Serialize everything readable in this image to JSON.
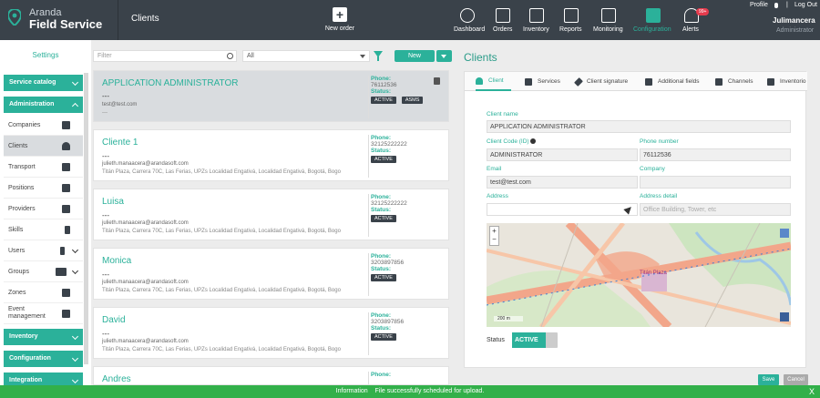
{
  "app": {
    "brand_top": "Aranda",
    "brand_bottom": "Field Service",
    "page_title": "Clients"
  },
  "header": {
    "new_order": "New order",
    "nav": [
      {
        "label": "Dashboard"
      },
      {
        "label": "Orders"
      },
      {
        "label": "Inventory"
      },
      {
        "label": "Reports"
      },
      {
        "label": "Monitoring"
      },
      {
        "label": "Configuration"
      },
      {
        "label": "Alerts"
      }
    ],
    "alerts_badge": "99+",
    "profile": "Profile",
    "logout": "Log Out",
    "user_name": "Julimancera",
    "user_role": "Administrator"
  },
  "sidebar": {
    "title": "Settings",
    "groups": {
      "service_catalog": "Service catalog",
      "administration": "Administration",
      "inventory": "Inventory",
      "configuration": "Configuration",
      "integration": "Integration"
    },
    "items": [
      "Companies",
      "Clients",
      "Transport",
      "Positions",
      "Providers",
      "Skills",
      "Users",
      "Groups",
      "Zones",
      "Event management"
    ]
  },
  "list": {
    "filter_placeholder": "Filter",
    "type_select": "All",
    "new_button": "New",
    "phone_label": "Phone:",
    "status_label": "Status:",
    "clients": [
      {
        "name": "APPLICATION ADMINISTRATOR",
        "sub": "---",
        "email": "test@test.com",
        "address": "---",
        "phone": "76112536",
        "tags": [
          "ACTIVE",
          "ASMS"
        ]
      },
      {
        "name": "Cliente 1",
        "sub": "---",
        "email": "julieth.manaacera@arandasoft.com",
        "address": "Titán Plaza, Carrera 70C, Las Ferias, UPZs Localidad Engativá, Localidad Engativá, Bogotá, Bogo",
        "phone": "32125222222",
        "tags": [
          "ACTIVE"
        ]
      },
      {
        "name": "Luisa",
        "sub": "---",
        "email": "julieth.manaacera@arandasoft.com",
        "address": "Titán Plaza, Carrera 70C, Las Ferias, UPZs Localidad Engativá, Localidad Engativá, Bogotá, Bogo",
        "phone": "32125222222",
        "tags": [
          "ACTIVE"
        ]
      },
      {
        "name": "Monica",
        "sub": "---",
        "email": "julieth.manaacera@arandasoft.com",
        "address": "Titán Plaza, Carrera 70C, Las Ferias, UPZs Localidad Engativá, Localidad Engativá, Bogotá, Bogo",
        "phone": "3203897856",
        "tags": [
          "ACTIVE"
        ]
      },
      {
        "name": "David",
        "sub": "---",
        "email": "julieth.manaacera@arandasoft.com",
        "address": "Titán Plaza, Carrera 70C, Las Ferias, UPZs Localidad Engativá, Localidad Engativá, Bogotá, Bogo",
        "phone": "3203897856",
        "tags": [
          "ACTIVE"
        ]
      },
      {
        "name": "Andres",
        "phone": ""
      }
    ]
  },
  "detail": {
    "title": "Clients",
    "tabs": [
      "Client",
      "Services",
      "Client signature",
      "Additional fields",
      "Channels",
      "Inventorio"
    ],
    "client_name_label": "Client name",
    "client_name": "APPLICATION ADMINISTRATOR",
    "client_code_label": "Client Code (ID)",
    "client_code": "ADMINISTRATOR",
    "phone_label": "Phone number",
    "phone": "76112536",
    "email_label": "Email",
    "email": "test@test.com",
    "company_label": "Company",
    "company": "",
    "address_label": "Address",
    "address": "",
    "address_detail_label": "Address detail",
    "address_detail_placeholder": "Office Building, Tower, etc",
    "map_labels": {
      "poi": "Titán Plaza",
      "scale": "200 m",
      "zoom_in": "+",
      "zoom_out": "−"
    },
    "status_label": "Status",
    "status_value": "ACTIVE",
    "save": "Save",
    "cancel": "Cancel"
  },
  "toast": {
    "label": "Information",
    "message": "File successfully scheduled for upload.",
    "close": "X"
  }
}
